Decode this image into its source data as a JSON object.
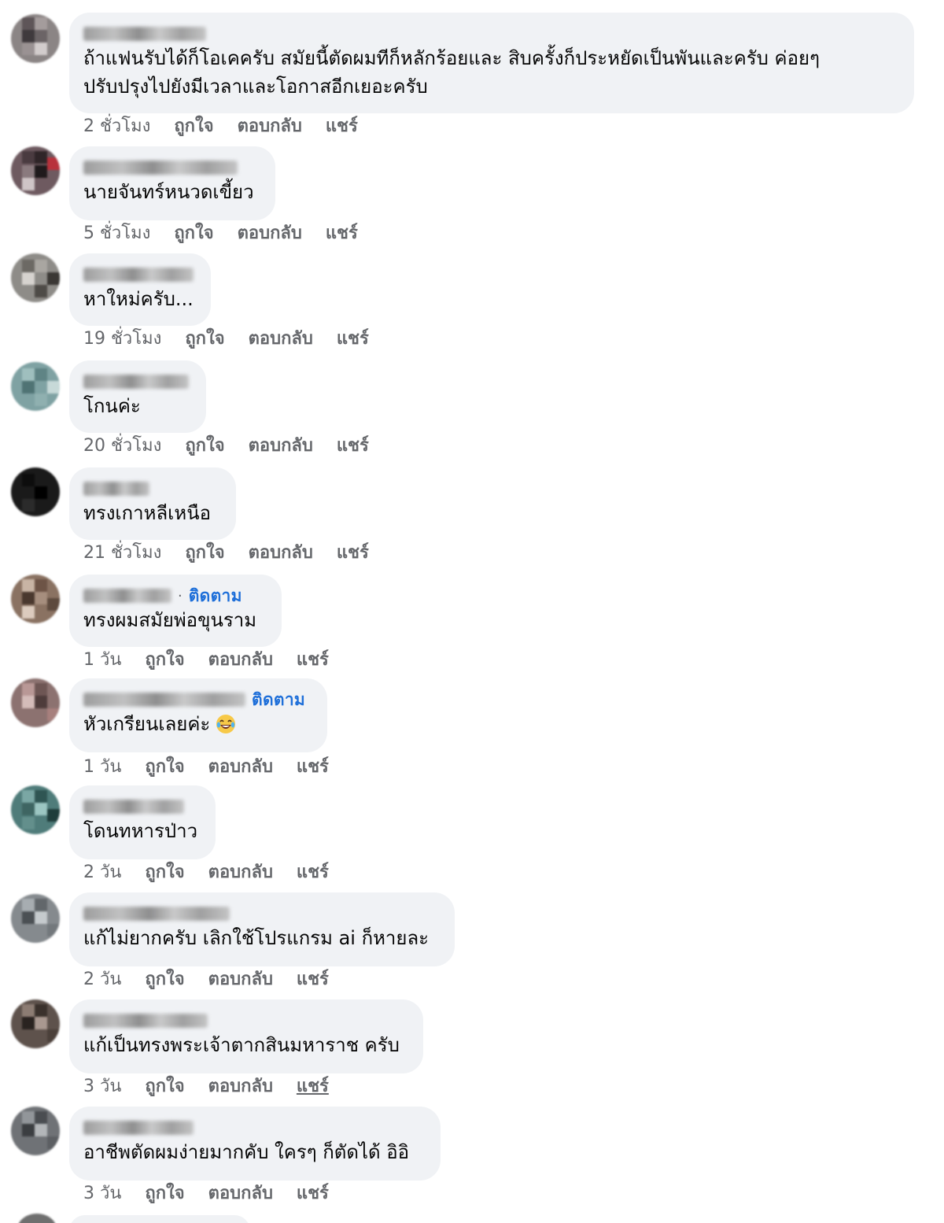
{
  "actions": {
    "like": "ถูกใจ",
    "reply": "ตอบกลับ",
    "share": "แชร์"
  },
  "comments": [
    {
      "text": "ถ้าแฟนรับได้ก็โอเคครับ สมัยนี้ตัดผมทีก็หลักร้อยและ สิบครั้งก็ประหยัดเป็นพันและครับ ค่อยๆ\nปรับปรุงไปยังมีเวลาและโอกาสอีกเยอะครับ",
      "time": "2 ชั่วโมง"
    },
    {
      "text": "นายจันทร์หนวดเขี้ยว",
      "time": "5 ชั่วโมง"
    },
    {
      "text": "หาใหม่ครับ...",
      "time": "19 ชั่วโมง"
    },
    {
      "text": "โกนค่ะ",
      "time": "20 ชั่วโมง"
    },
    {
      "text": "ทรงเกาหลีเหนือ",
      "time": "21 ชั่วโมง"
    },
    {
      "follow": "ติดตาม",
      "text": "ทรงผมสมัยพ่อขุนราม",
      "time": "1 วัน"
    },
    {
      "follow": "ติดตาม",
      "text": "หัวเกรียนเลยค่ะ",
      "emoji": "laughing-tears-emoji",
      "time": "1 วัน"
    },
    {
      "text": "โดนทหารป่าว",
      "time": "2 วัน"
    },
    {
      "text": "แก้ไม่ยากครับ เลิกใช้โปรแกรม ai ก็หายละ",
      "time": "2 วัน"
    },
    {
      "text": "แก้เป็นทรงพระเจ้าตากสินมหาราช ครับ",
      "time": "3 วัน",
      "share_underlined": true
    },
    {
      "text": "อาชีพตัดผมง่ายมากคับ ใครๆ ก็ตัดได้ อิอิ",
      "time": "3 วัน"
    }
  ],
  "colors": {
    "bubble": "#f0f2f5",
    "text": "#050505",
    "meta": "#65676b",
    "follow": "#1e6fd9"
  }
}
